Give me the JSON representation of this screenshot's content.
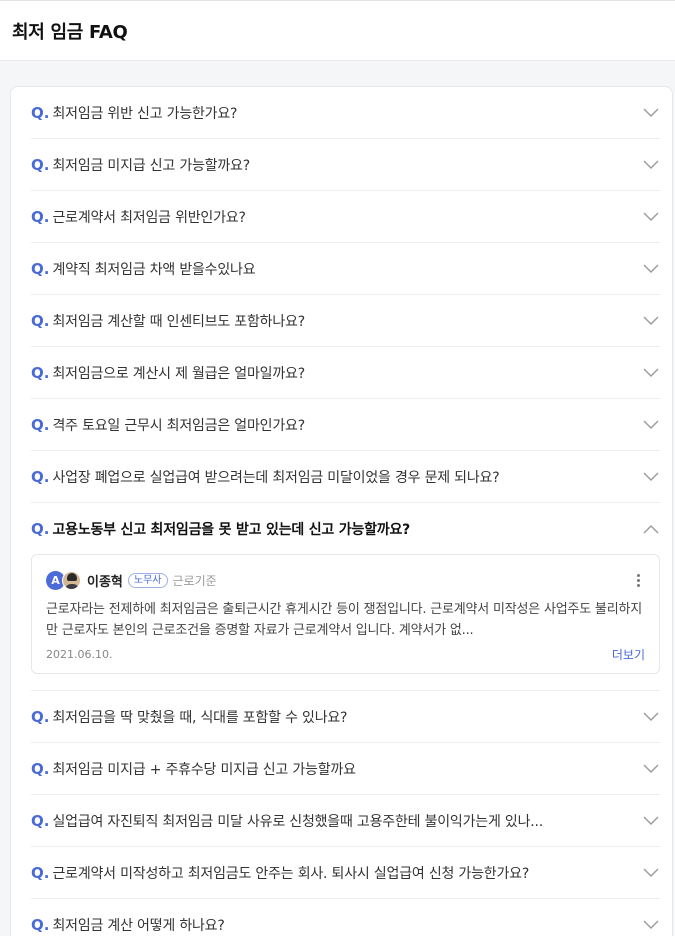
{
  "header": {
    "title": "최저 임금 FAQ"
  },
  "q_prefix": "Q.",
  "faq": [
    {
      "question": "최저임금 위반 신고 가능한가요?",
      "open": false
    },
    {
      "question": "최저임금 미지급 신고 가능할까요?",
      "open": false
    },
    {
      "question": "근로계약서 최저임금 위반인가요?",
      "open": false
    },
    {
      "question": "계약직 최저임금 차액 받을수있나요",
      "open": false
    },
    {
      "question": "최저임금 계산할 때 인센티브도 포함하나요?",
      "open": false
    },
    {
      "question": "최저임금으로 계산시 제 월급은 얼마일까요?",
      "open": false
    },
    {
      "question": "격주 토요일 근무시 최저임금은 얼마인가요?",
      "open": false
    },
    {
      "question": "사업장 폐업으로 실업급여 받으려는데 최저임금 미달이었을 경우 문제 되나요?",
      "open": false
    },
    {
      "question": "고용노동부 신고 최저임금을 못 받고 있는데 신고 가능할까요?",
      "open": true
    },
    {
      "question": "최저임금을 딱 맞췄을 때, 식대를 포함할 수 있나요?",
      "open": false
    },
    {
      "question": "최저임금 미지급 + 주휴수당 미지급 신고 가능할까요",
      "open": false
    },
    {
      "question": "실업급여 자진퇴직 최저임금 미달 사유로 신청했을때 고용주한테 불이익가는게 있나...",
      "open": false
    },
    {
      "question": "근로계약서 미작성하고 최저임금도 안주는 회사. 퇴사시 실업급여 신청 가능한가요?",
      "open": false
    },
    {
      "question": "최저임금 계산 어떻게 하나요?",
      "open": false
    }
  ],
  "answer": {
    "avatar_letter": "A",
    "name": "이종혁",
    "badge": "노무사",
    "category": "근로기준",
    "body": "근로자라는 전제하에 최저임금은 출퇴근시간 휴게시간 등이 쟁점입니다. 근로계약서 미작성은 사업주도 불리하지만 근로자도 본인의 근로조건을 증명할 자료가 근로계약서 입니다. 계약서가 없...",
    "date": "2021.06.10.",
    "more_label": "더보기"
  },
  "colors": {
    "accent": "#4a6bd7"
  },
  "icons": {
    "collapsed": "chevron-down-icon",
    "expanded": "chevron-up-icon",
    "menu": "more-vertical-icon"
  }
}
